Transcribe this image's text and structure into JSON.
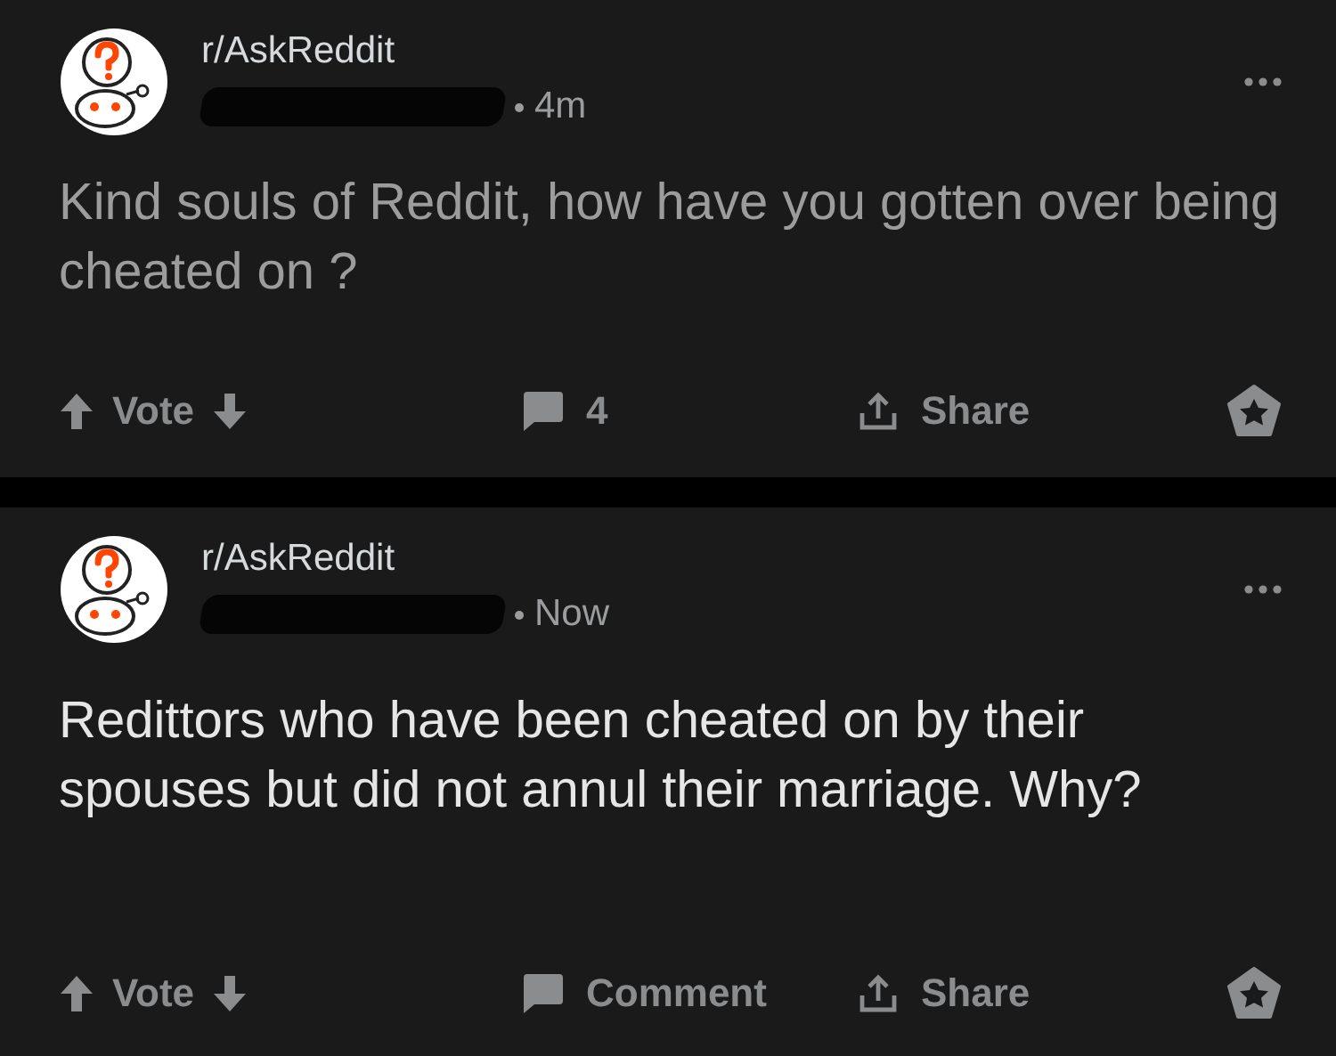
{
  "posts": [
    {
      "subreddit": "r/AskReddit",
      "time": "4m",
      "title": "Kind souls of Reddit, how have you gotten over being cheated on ?",
      "read": true,
      "actions": {
        "vote": "Vote",
        "comments": "4",
        "share": "Share"
      }
    },
    {
      "subreddit": "r/AskReddit",
      "time": "Now",
      "title": "Redittors who have been cheated on by their spouses but did not annul their marriage. Why?",
      "read": false,
      "actions": {
        "vote": "Vote",
        "comments": "Comment",
        "share": "Share"
      }
    }
  ]
}
